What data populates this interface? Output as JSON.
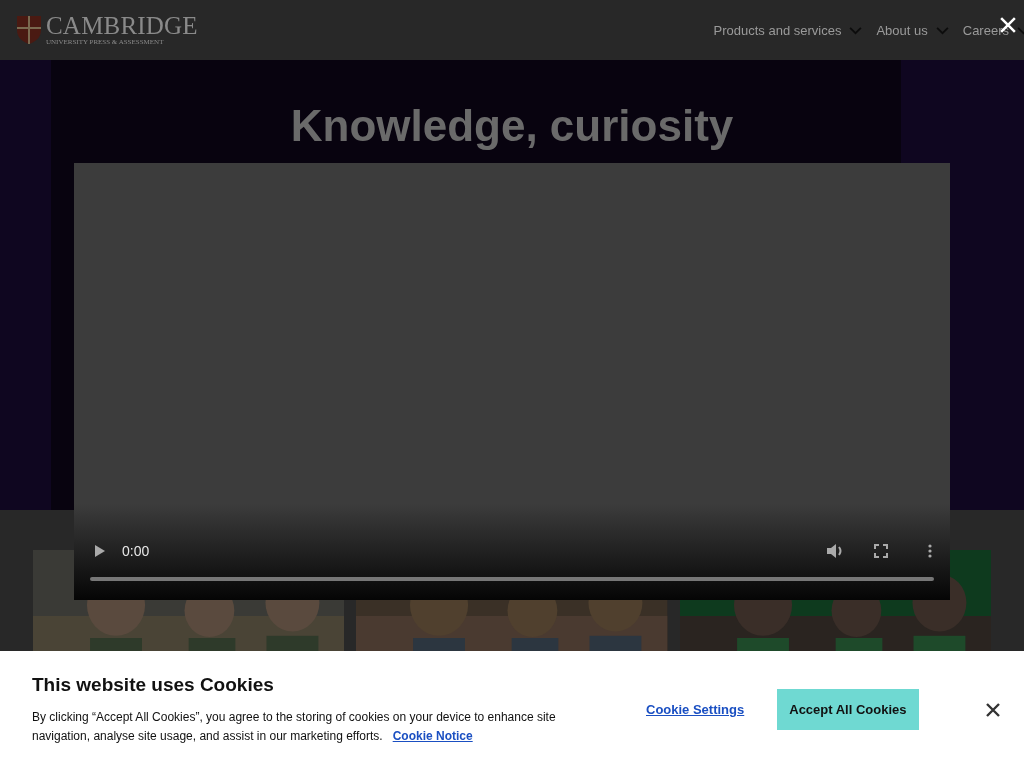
{
  "header": {
    "logo": {
      "name": "CAMBRIDGE",
      "subtitle": "UNIVERSITY PRESS & ASSESSMENT"
    },
    "nav": [
      {
        "label": "Products and services"
      },
      {
        "label": "About us"
      },
      {
        "label": "Careers"
      }
    ]
  },
  "hero": {
    "heading": "Knowledge, curiosity"
  },
  "video": {
    "time": "0:00"
  },
  "cookie_banner": {
    "title": "This website uses Cookies",
    "text": "By clicking “Accept All Cookies”, you agree to the storing of cookies on your device to enhance site navigation, analyse site usage, and assist in our marketing efforts.",
    "link": "Cookie Notice",
    "settings_button": "Cookie Settings",
    "accept_button": "Accept All Cookies"
  }
}
